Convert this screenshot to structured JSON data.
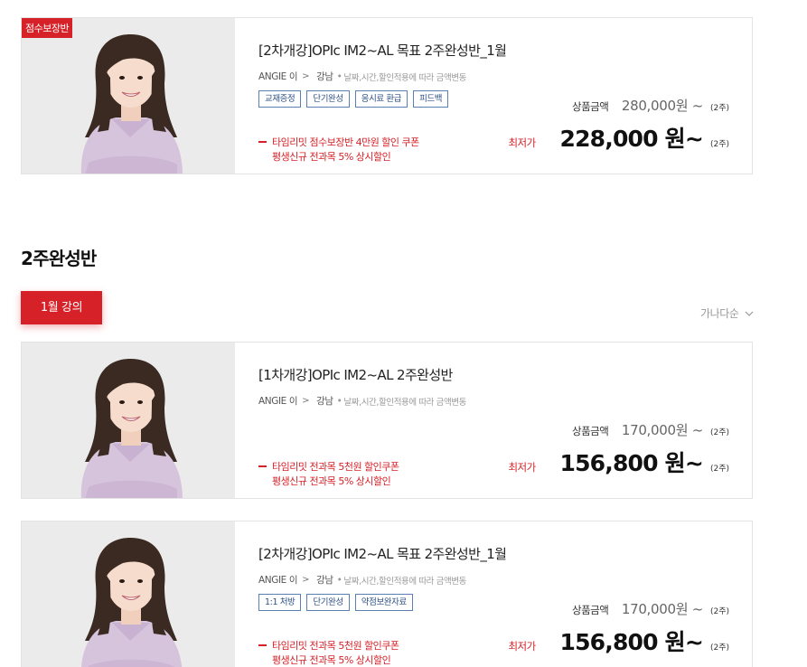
{
  "top_card": {
    "badge": "점수보장반",
    "title": "[2차개강]OPIc IM2~AL 목표 2주완성반_1월",
    "instructor": "ANGIE 이",
    "campus": "강남",
    "price_note": "날짜,시간,할인적용에 따라 금액변동",
    "tags": [
      "교재증정",
      "단기완성",
      "응시료 환급",
      "피드백"
    ],
    "promos": [
      "타임리밋 점수보장반 4만원 할인 쿠폰",
      "평생신규 전과목 5% 상시할인"
    ],
    "original_label": "상품금액",
    "original_price": "280,000원 ~",
    "original_period": "(2주)",
    "lowest_label": "최저가",
    "lowest_price": "228,000 원~",
    "lowest_period": "(2주)"
  },
  "section": {
    "title": "2주완성반",
    "month_button": "1월 강의",
    "sort_label": "가나다순"
  },
  "cards": [
    {
      "title": "[1차개강]OPIc IM2~AL 2주완성반",
      "instructor": "ANGIE 이",
      "campus": "강남",
      "price_note": "날짜,시간,할인적용에 따라 금액변동",
      "tags": [],
      "promos": [
        "타임리밋 전과목 5천원 할인쿠폰",
        "평생신규 전과목 5% 상시할인"
      ],
      "original_label": "상품금액",
      "original_price": "170,000원 ~",
      "original_period": "(2주)",
      "lowest_label": "최저가",
      "lowest_price": "156,800 원~",
      "lowest_period": "(2주)"
    },
    {
      "title": "[2차개강]OPIc IM2~AL 목표 2주완성반_1월",
      "instructor": "ANGIE 이",
      "campus": "강남",
      "price_note": "날짜,시간,할인적용에 따라 금액변동",
      "tags": [
        "1:1 처방",
        "단기완성",
        "약점보완자료"
      ],
      "promos": [
        "타임리밋 전과목 5천원 할인쿠폰",
        "평생신규 전과목 5% 상시할인"
      ],
      "original_label": "상품금액",
      "original_price": "170,000원 ~",
      "original_period": "(2주)",
      "lowest_label": "최저가",
      "lowest_price": "156,800 원~",
      "lowest_period": "(2주)"
    }
  ],
  "colors": {
    "accent": "#d62128",
    "tag_border": "#5c7fb3",
    "thumb_bg": "#ebebeb"
  }
}
